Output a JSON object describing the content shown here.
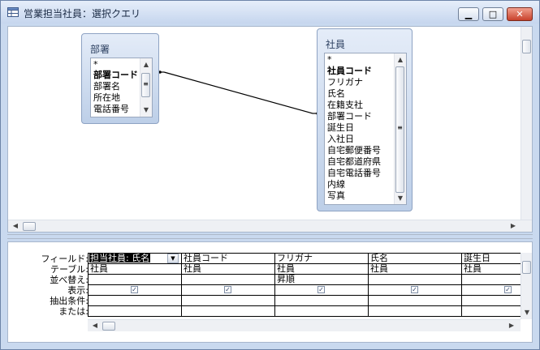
{
  "window": {
    "title": "営業担当社員：選択クエリ",
    "buttons": {
      "minimize": "▁",
      "maximize": "□",
      "close": "✕"
    }
  },
  "tables": {
    "busho": {
      "title": "部署",
      "fields": [
        {
          "label": "*",
          "key": false
        },
        {
          "label": "部署コード",
          "key": true
        },
        {
          "label": "部署名",
          "key": false
        },
        {
          "label": "所在地",
          "key": false
        },
        {
          "label": "電話番号",
          "key": false
        }
      ]
    },
    "shain": {
      "title": "社員",
      "fields": [
        {
          "label": "*",
          "key": false
        },
        {
          "label": "社員コード",
          "key": true
        },
        {
          "label": "フリガナ",
          "key": false
        },
        {
          "label": "氏名",
          "key": false
        },
        {
          "label": "在籍支社",
          "key": false
        },
        {
          "label": "部署コード",
          "key": false
        },
        {
          "label": "誕生日",
          "key": false
        },
        {
          "label": "入社日",
          "key": false
        },
        {
          "label": "自宅郵便番号",
          "key": false
        },
        {
          "label": "自宅都道府県",
          "key": false
        },
        {
          "label": "自宅電話番号",
          "key": false
        },
        {
          "label": "内線",
          "key": false
        },
        {
          "label": "写真",
          "key": false
        }
      ]
    }
  },
  "grid": {
    "row_labels": [
      "フィールド:",
      "テーブル:",
      "並べ替え:",
      "表示:",
      "抽出条件:",
      "または:"
    ],
    "columns": [
      {
        "field": "担当社員: 氏名",
        "table": "社員",
        "sort": "",
        "show": true
      },
      {
        "field": "社員コード",
        "table": "社員",
        "sort": "",
        "show": true
      },
      {
        "field": "フリガナ",
        "table": "社員",
        "sort": "昇順",
        "show": true
      },
      {
        "field": "氏名",
        "table": "社員",
        "sort": "",
        "show": true
      },
      {
        "field": "誕生日",
        "table": "社員",
        "sort": "",
        "show": true
      }
    ]
  },
  "icons": {
    "check": "✓",
    "up": "▲",
    "down": "▼",
    "left": "◀",
    "right": "▶",
    "grip": "≡",
    "dropdown": "▼"
  }
}
